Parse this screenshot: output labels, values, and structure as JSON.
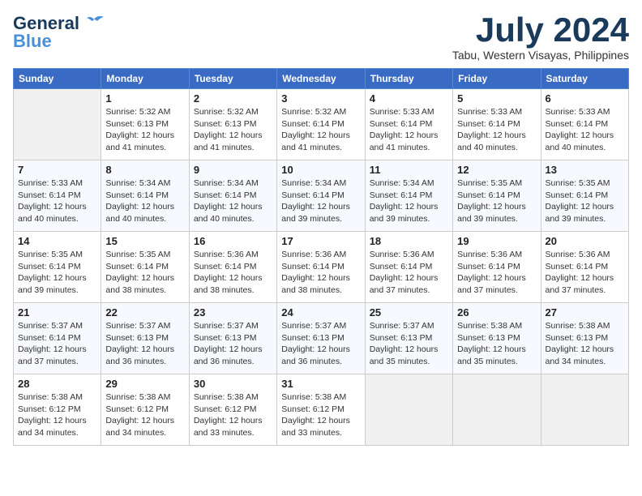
{
  "header": {
    "logo_line1": "General",
    "logo_line2": "Blue",
    "month_year": "July 2024",
    "location": "Tabu, Western Visayas, Philippines"
  },
  "weekdays": [
    "Sunday",
    "Monday",
    "Tuesday",
    "Wednesday",
    "Thursday",
    "Friday",
    "Saturday"
  ],
  "weeks": [
    [
      {
        "day": "",
        "sunrise": "",
        "sunset": "",
        "daylight": ""
      },
      {
        "day": "1",
        "sunrise": "Sunrise: 5:32 AM",
        "sunset": "Sunset: 6:13 PM",
        "daylight": "Daylight: 12 hours and 41 minutes."
      },
      {
        "day": "2",
        "sunrise": "Sunrise: 5:32 AM",
        "sunset": "Sunset: 6:13 PM",
        "daylight": "Daylight: 12 hours and 41 minutes."
      },
      {
        "day": "3",
        "sunrise": "Sunrise: 5:32 AM",
        "sunset": "Sunset: 6:14 PM",
        "daylight": "Daylight: 12 hours and 41 minutes."
      },
      {
        "day": "4",
        "sunrise": "Sunrise: 5:33 AM",
        "sunset": "Sunset: 6:14 PM",
        "daylight": "Daylight: 12 hours and 41 minutes."
      },
      {
        "day": "5",
        "sunrise": "Sunrise: 5:33 AM",
        "sunset": "Sunset: 6:14 PM",
        "daylight": "Daylight: 12 hours and 40 minutes."
      },
      {
        "day": "6",
        "sunrise": "Sunrise: 5:33 AM",
        "sunset": "Sunset: 6:14 PM",
        "daylight": "Daylight: 12 hours and 40 minutes."
      }
    ],
    [
      {
        "day": "7",
        "sunrise": "Sunrise: 5:33 AM",
        "sunset": "Sunset: 6:14 PM",
        "daylight": "Daylight: 12 hours and 40 minutes."
      },
      {
        "day": "8",
        "sunrise": "Sunrise: 5:34 AM",
        "sunset": "Sunset: 6:14 PM",
        "daylight": "Daylight: 12 hours and 40 minutes."
      },
      {
        "day": "9",
        "sunrise": "Sunrise: 5:34 AM",
        "sunset": "Sunset: 6:14 PM",
        "daylight": "Daylight: 12 hours and 40 minutes."
      },
      {
        "day": "10",
        "sunrise": "Sunrise: 5:34 AM",
        "sunset": "Sunset: 6:14 PM",
        "daylight": "Daylight: 12 hours and 39 minutes."
      },
      {
        "day": "11",
        "sunrise": "Sunrise: 5:34 AM",
        "sunset": "Sunset: 6:14 PM",
        "daylight": "Daylight: 12 hours and 39 minutes."
      },
      {
        "day": "12",
        "sunrise": "Sunrise: 5:35 AM",
        "sunset": "Sunset: 6:14 PM",
        "daylight": "Daylight: 12 hours and 39 minutes."
      },
      {
        "day": "13",
        "sunrise": "Sunrise: 5:35 AM",
        "sunset": "Sunset: 6:14 PM",
        "daylight": "Daylight: 12 hours and 39 minutes."
      }
    ],
    [
      {
        "day": "14",
        "sunrise": "Sunrise: 5:35 AM",
        "sunset": "Sunset: 6:14 PM",
        "daylight": "Daylight: 12 hours and 39 minutes."
      },
      {
        "day": "15",
        "sunrise": "Sunrise: 5:35 AM",
        "sunset": "Sunset: 6:14 PM",
        "daylight": "Daylight: 12 hours and 38 minutes."
      },
      {
        "day": "16",
        "sunrise": "Sunrise: 5:36 AM",
        "sunset": "Sunset: 6:14 PM",
        "daylight": "Daylight: 12 hours and 38 minutes."
      },
      {
        "day": "17",
        "sunrise": "Sunrise: 5:36 AM",
        "sunset": "Sunset: 6:14 PM",
        "daylight": "Daylight: 12 hours and 38 minutes."
      },
      {
        "day": "18",
        "sunrise": "Sunrise: 5:36 AM",
        "sunset": "Sunset: 6:14 PM",
        "daylight": "Daylight: 12 hours and 37 minutes."
      },
      {
        "day": "19",
        "sunrise": "Sunrise: 5:36 AM",
        "sunset": "Sunset: 6:14 PM",
        "daylight": "Daylight: 12 hours and 37 minutes."
      },
      {
        "day": "20",
        "sunrise": "Sunrise: 5:36 AM",
        "sunset": "Sunset: 6:14 PM",
        "daylight": "Daylight: 12 hours and 37 minutes."
      }
    ],
    [
      {
        "day": "21",
        "sunrise": "Sunrise: 5:37 AM",
        "sunset": "Sunset: 6:14 PM",
        "daylight": "Daylight: 12 hours and 37 minutes."
      },
      {
        "day": "22",
        "sunrise": "Sunrise: 5:37 AM",
        "sunset": "Sunset: 6:13 PM",
        "daylight": "Daylight: 12 hours and 36 minutes."
      },
      {
        "day": "23",
        "sunrise": "Sunrise: 5:37 AM",
        "sunset": "Sunset: 6:13 PM",
        "daylight": "Daylight: 12 hours and 36 minutes."
      },
      {
        "day": "24",
        "sunrise": "Sunrise: 5:37 AM",
        "sunset": "Sunset: 6:13 PM",
        "daylight": "Daylight: 12 hours and 36 minutes."
      },
      {
        "day": "25",
        "sunrise": "Sunrise: 5:37 AM",
        "sunset": "Sunset: 6:13 PM",
        "daylight": "Daylight: 12 hours and 35 minutes."
      },
      {
        "day": "26",
        "sunrise": "Sunrise: 5:38 AM",
        "sunset": "Sunset: 6:13 PM",
        "daylight": "Daylight: 12 hours and 35 minutes."
      },
      {
        "day": "27",
        "sunrise": "Sunrise: 5:38 AM",
        "sunset": "Sunset: 6:13 PM",
        "daylight": "Daylight: 12 hours and 34 minutes."
      }
    ],
    [
      {
        "day": "28",
        "sunrise": "Sunrise: 5:38 AM",
        "sunset": "Sunset: 6:12 PM",
        "daylight": "Daylight: 12 hours and 34 minutes."
      },
      {
        "day": "29",
        "sunrise": "Sunrise: 5:38 AM",
        "sunset": "Sunset: 6:12 PM",
        "daylight": "Daylight: 12 hours and 34 minutes."
      },
      {
        "day": "30",
        "sunrise": "Sunrise: 5:38 AM",
        "sunset": "Sunset: 6:12 PM",
        "daylight": "Daylight: 12 hours and 33 minutes."
      },
      {
        "day": "31",
        "sunrise": "Sunrise: 5:38 AM",
        "sunset": "Sunset: 6:12 PM",
        "daylight": "Daylight: 12 hours and 33 minutes."
      },
      {
        "day": "",
        "sunrise": "",
        "sunset": "",
        "daylight": ""
      },
      {
        "day": "",
        "sunrise": "",
        "sunset": "",
        "daylight": ""
      },
      {
        "day": "",
        "sunrise": "",
        "sunset": "",
        "daylight": ""
      }
    ]
  ]
}
